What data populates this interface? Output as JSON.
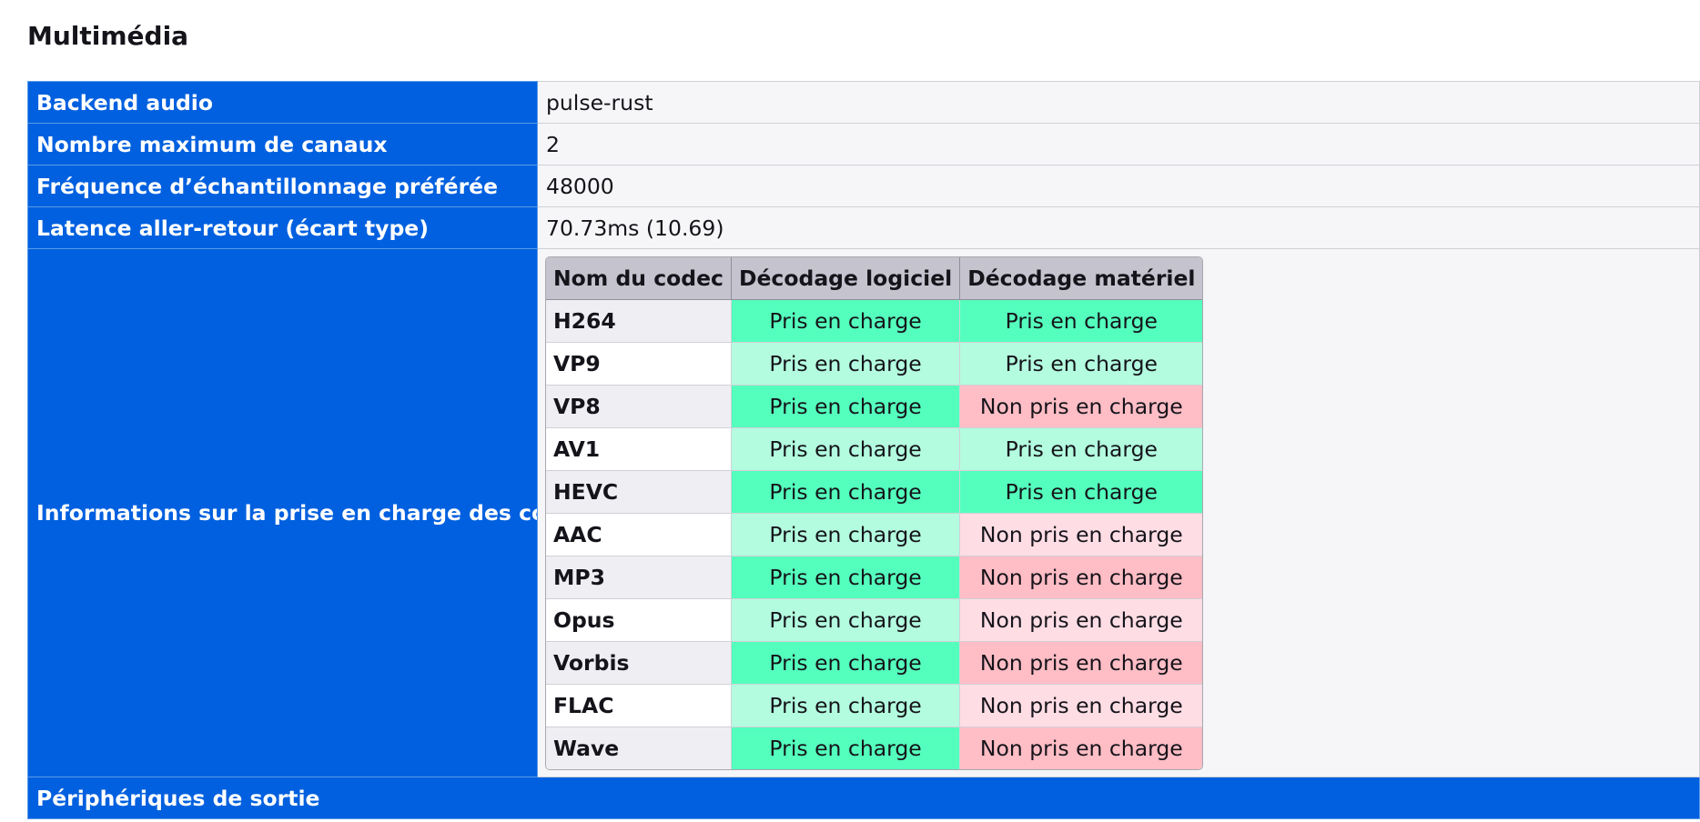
{
  "section_title": "Multimédia",
  "rows": [
    {
      "label": "Backend audio",
      "value": "pulse-rust"
    },
    {
      "label": "Nombre maximum de canaux",
      "value": "2"
    },
    {
      "label": "Fréquence d’échantillonnage préférée",
      "value": "48000"
    },
    {
      "label": "Latence aller-retour (écart type)",
      "value": "70.73ms (10.69)"
    }
  ],
  "codec_row_label": "Informations sur la prise en charge des codecs",
  "codec_table": {
    "headers": [
      "Nom du codec",
      "Décodage logiciel",
      "Décodage matériel"
    ],
    "supported_label": "Pris en charge",
    "unsupported_label": "Non pris en charge",
    "rows": [
      {
        "name": "H264",
        "software": "Pris en charge",
        "hardware": "Pris en charge"
      },
      {
        "name": "VP9",
        "software": "Pris en charge",
        "hardware": "Pris en charge"
      },
      {
        "name": "VP8",
        "software": "Pris en charge",
        "hardware": "Non pris en charge"
      },
      {
        "name": "AV1",
        "software": "Pris en charge",
        "hardware": "Pris en charge"
      },
      {
        "name": "HEVC",
        "software": "Pris en charge",
        "hardware": "Pris en charge"
      },
      {
        "name": "AAC",
        "software": "Pris en charge",
        "hardware": "Non pris en charge"
      },
      {
        "name": "MP3",
        "software": "Pris en charge",
        "hardware": "Non pris en charge"
      },
      {
        "name": "Opus",
        "software": "Pris en charge",
        "hardware": "Non pris en charge"
      },
      {
        "name": "Vorbis",
        "software": "Pris en charge",
        "hardware": "Non pris en charge"
      },
      {
        "name": "FLAC",
        "software": "Pris en charge",
        "hardware": "Non pris en charge"
      },
      {
        "name": "Wave",
        "software": "Pris en charge",
        "hardware": "Non pris en charge"
      }
    ]
  },
  "output_devices_label": "Périphériques de sortie",
  "colors": {
    "header_blue": "#0060df",
    "supported_strong": "#54ffbd",
    "supported_light": "#b3fcdf",
    "unsupported_strong": "#ffbdc5",
    "unsupported_light": "#ffdde5"
  }
}
